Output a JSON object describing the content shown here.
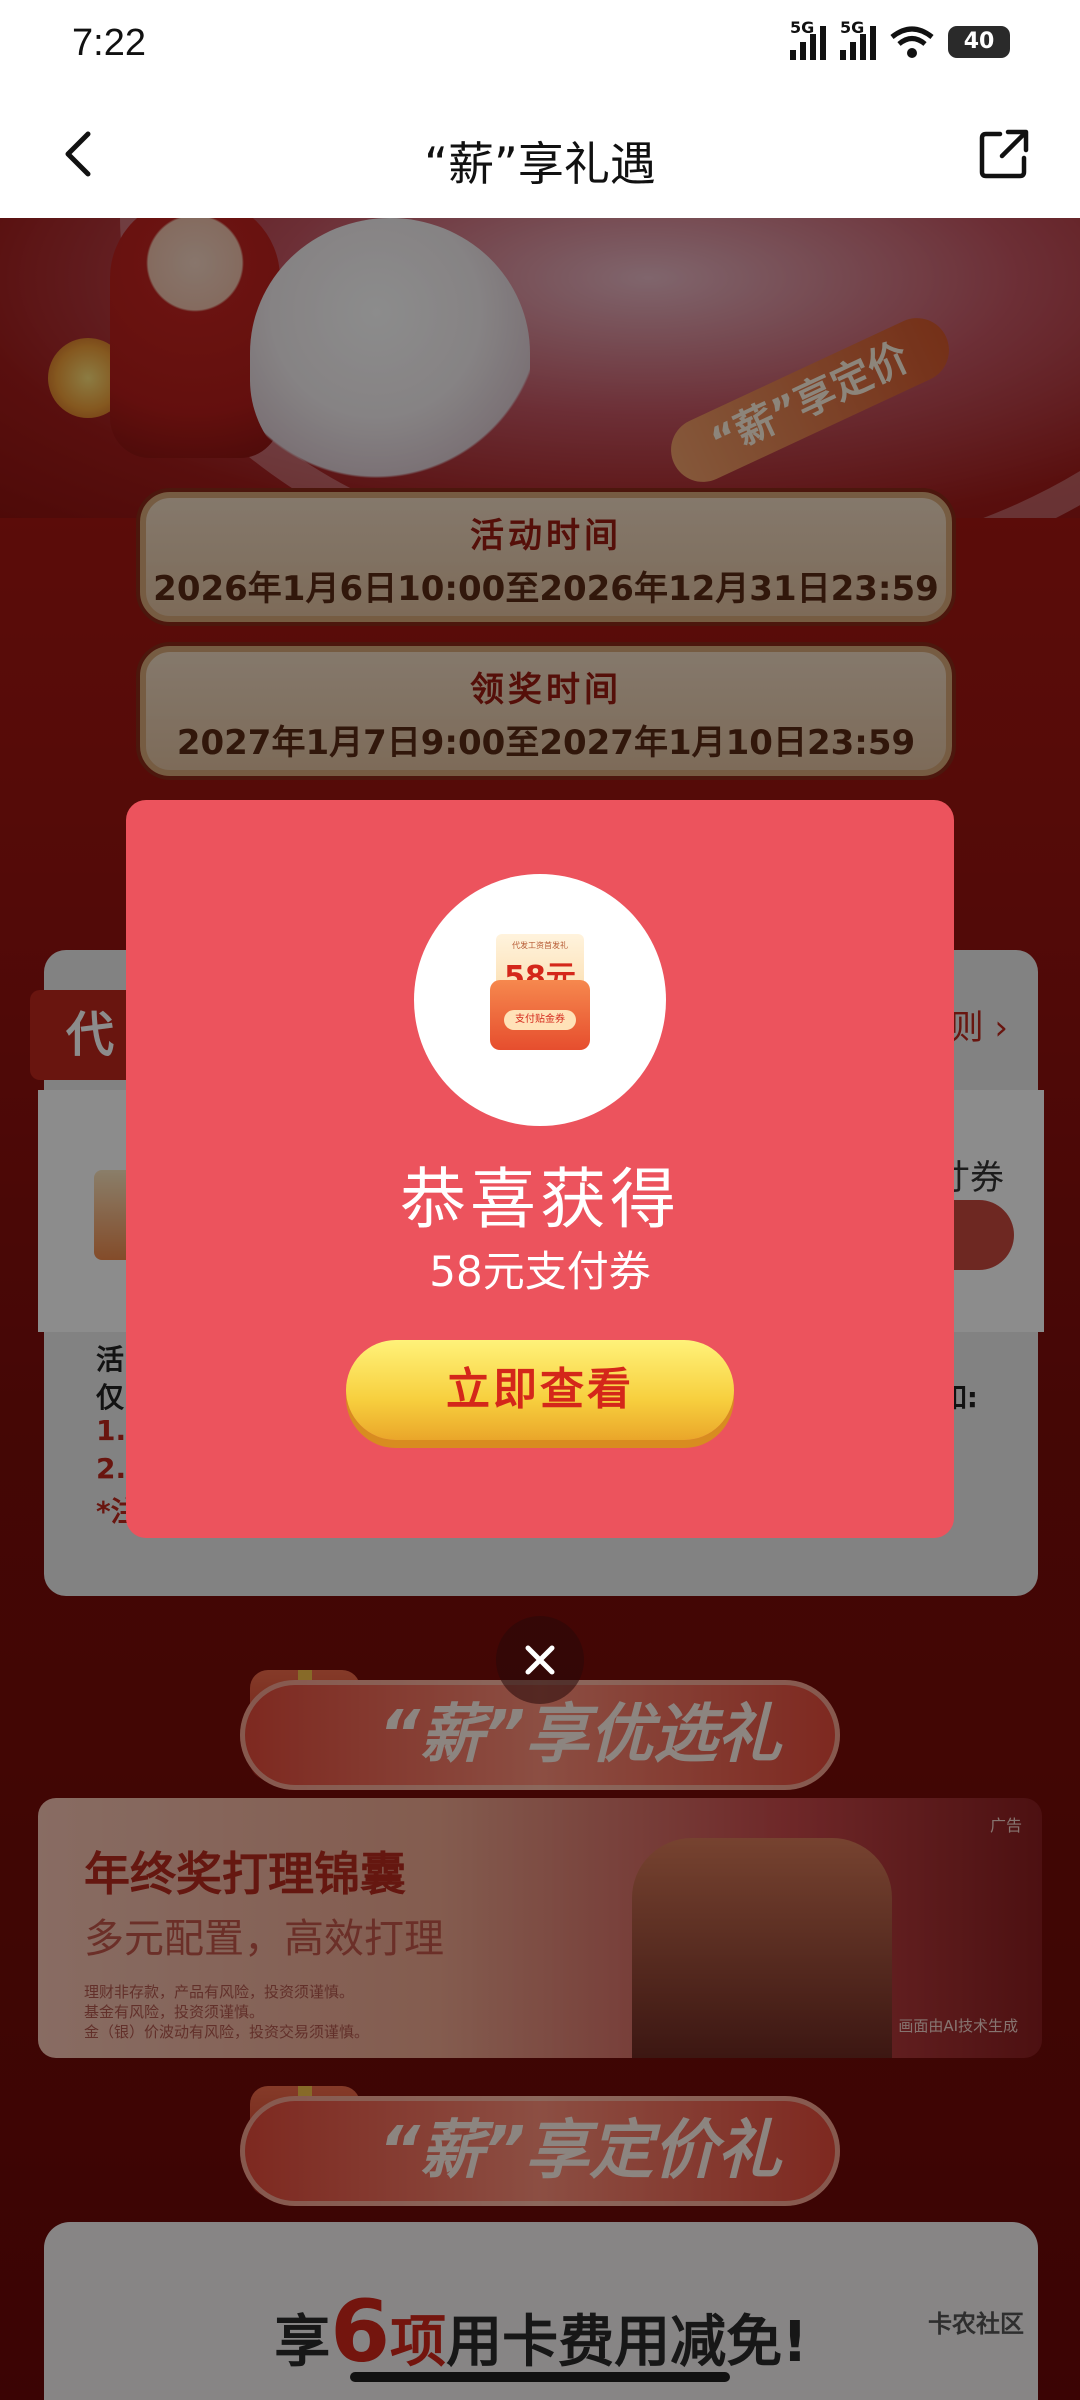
{
  "status_bar": {
    "time": "7:22",
    "signal1_label": "5G",
    "signal2_label": "5G",
    "battery": "40"
  },
  "nav": {
    "title": "“薪”享礼遇"
  },
  "hero": {
    "tag": "“薪”享定价"
  },
  "activity_time": {
    "heading": "活动时间",
    "value": "2026年1月6日10:00至2026年12月31日23:59"
  },
  "prize_time": {
    "heading": "领奖时间",
    "value": "2027年1月7日9:00至2027年1月10日23:59"
  },
  "rule_panel": {
    "tab_label": "代",
    "rule_link": "则 ›",
    "coupon_label": "寸券",
    "note_line1": "活",
    "note_line2": "仅",
    "note_line3": "1.",
    "note_line4": "2.",
    "note_line5": "*注",
    "note_right": "如:"
  },
  "section_preferred": "“薪”享优选礼",
  "ad": {
    "tag": "广告",
    "title": "年终奖打理锦囊",
    "subtitle": "多元配置，高效打理",
    "disclaimer1": "理财非存款，产品有风险，投资须谨慎。",
    "disclaimer2": "基金有风险，投资须谨慎。",
    "disclaimer3": "金（银）价波动有风险，投资交易须谨慎。",
    "ai_note": "画面由AI技术生成"
  },
  "section_fixed": "“薪”享定价礼",
  "fee_card": {
    "prefix": "享",
    "count": "6",
    "suffix1": "项",
    "suffix2": "用卡费用减免!"
  },
  "watermark": "卡农社区",
  "popup": {
    "coupon_mini_text": "代发工资首发礼",
    "coupon_amount": "58元",
    "coupon_label": "支付贴金券",
    "title": "恭喜获得",
    "subtitle": "58元支付券",
    "button": "立即查看",
    "close_symbol": "✕"
  }
}
